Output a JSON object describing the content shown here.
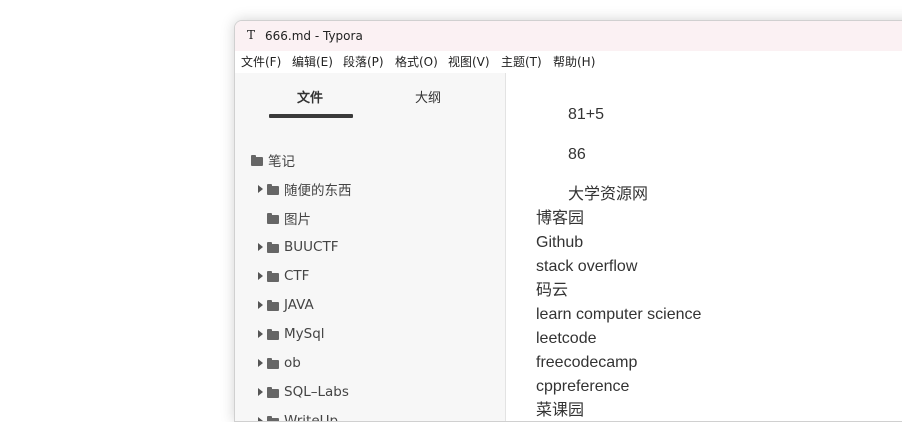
{
  "window": {
    "app_icon_glyph": "T",
    "title": "666.md - Typora"
  },
  "menubar": [
    "文件(F)",
    "编辑(E)",
    "段落(P)",
    "格式(O)",
    "视图(V)",
    "主题(T)",
    "帮助(H)"
  ],
  "sidebar": {
    "tabs": {
      "files": "文件",
      "outline": "大纲"
    },
    "root": "笔记",
    "items": [
      {
        "label": "随便的东西",
        "expandable": true
      },
      {
        "label": "图片",
        "expandable": false
      },
      {
        "label": "BUUCTF",
        "expandable": true
      },
      {
        "label": "CTF",
        "expandable": true
      },
      {
        "label": "JAVA",
        "expandable": true
      },
      {
        "label": "MySql",
        "expandable": true
      },
      {
        "label": "ob",
        "expandable": true
      },
      {
        "label": "SQL–Labs",
        "expandable": true
      },
      {
        "label": "WriteUp",
        "expandable": true
      }
    ]
  },
  "editor": {
    "indented_lines": [
      "81+5",
      "86",
      "大学资源网"
    ],
    "lines": [
      "博客园",
      "Github",
      "stack overflow",
      "码云",
      "learn computer science",
      "leetcode",
      "freecodecamp",
      "cppreference",
      "菜课园"
    ]
  }
}
